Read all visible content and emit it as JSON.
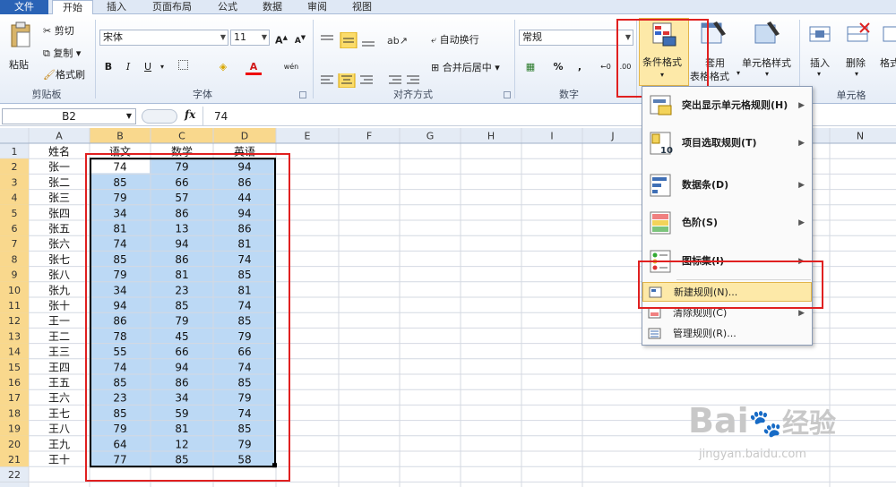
{
  "tabs": [
    "文件",
    "开始",
    "插入",
    "页面布局",
    "公式",
    "数据",
    "审阅",
    "视图"
  ],
  "clipboard": {
    "paste": "粘贴",
    "cut": "剪切",
    "copy": "复制",
    "format_painter": "格式刷",
    "group": "剪贴板"
  },
  "font": {
    "name": "宋体",
    "size": "11",
    "bold": "B",
    "italic": "I",
    "underline": "U",
    "font_color": "A",
    "group": "字体",
    "wen": "wén"
  },
  "alignment": {
    "wrap": "自动换行",
    "merge": "合并后居中",
    "group": "对齐方式"
  },
  "number": {
    "format": "常规",
    "percent": "%",
    "comma": ",",
    "group": "数字"
  },
  "styles": {
    "conditional": "条件格式",
    "table1": "套用",
    "table2": "表格格式",
    "cell_styles": "单元格样式"
  },
  "cells": {
    "insert": "插入",
    "delete": "删除",
    "format": "格式",
    "group": "单元格"
  },
  "formula_bar": {
    "name_box": "B2",
    "fx": "fx",
    "value": "74"
  },
  "columns": [
    "A",
    "B",
    "C",
    "D",
    "E",
    "F",
    "G",
    "H",
    "I",
    "J",
    "N"
  ],
  "rows": [
    [
      "1",
      "姓名",
      "语文",
      "数学",
      "英语"
    ],
    [
      "2",
      "张一",
      "74",
      "79",
      "94"
    ],
    [
      "3",
      "张二",
      "85",
      "66",
      "86"
    ],
    [
      "4",
      "张三",
      "79",
      "57",
      "44"
    ],
    [
      "5",
      "张四",
      "34",
      "86",
      "94"
    ],
    [
      "6",
      "张五",
      "81",
      "13",
      "86"
    ],
    [
      "7",
      "张六",
      "74",
      "94",
      "81"
    ],
    [
      "8",
      "张七",
      "85",
      "86",
      "74"
    ],
    [
      "9",
      "张八",
      "79",
      "81",
      "85"
    ],
    [
      "10",
      "张九",
      "34",
      "23",
      "81"
    ],
    [
      "11",
      "张十",
      "94",
      "85",
      "74"
    ],
    [
      "12",
      "王一",
      "86",
      "79",
      "85"
    ],
    [
      "13",
      "王二",
      "78",
      "45",
      "79"
    ],
    [
      "14",
      "王三",
      "55",
      "66",
      "66"
    ],
    [
      "15",
      "王四",
      "74",
      "94",
      "74"
    ],
    [
      "16",
      "王五",
      "85",
      "86",
      "85"
    ],
    [
      "17",
      "王六",
      "23",
      "34",
      "79"
    ],
    [
      "18",
      "王七",
      "85",
      "59",
      "74"
    ],
    [
      "19",
      "王八",
      "79",
      "81",
      "85"
    ],
    [
      "20",
      "王九",
      "64",
      "12",
      "79"
    ],
    [
      "21",
      "王十",
      "77",
      "85",
      "58"
    ],
    [
      "22",
      "",
      "",
      "",
      ""
    ]
  ],
  "menu": {
    "highlight": "突出显示单元格规则(H)",
    "top_bottom": "项目选取规则(T)",
    "data_bars": "数据条(D)",
    "color_scales": "色阶(S)",
    "icon_sets": "图标集(I)",
    "new_rule": "新建规则(N)...",
    "clear_rules": "清除规则(C)",
    "manage_rules": "管理规则(R)..."
  },
  "watermark": {
    "brand": "Bai",
    "brand2": "经验",
    "url": "jingyan.baidu.com"
  },
  "colors": {
    "accent_red": "#e02020",
    "selection": "#bcd9f5",
    "header": "#e4ebf5",
    "file_tab": "#2a63b6"
  }
}
